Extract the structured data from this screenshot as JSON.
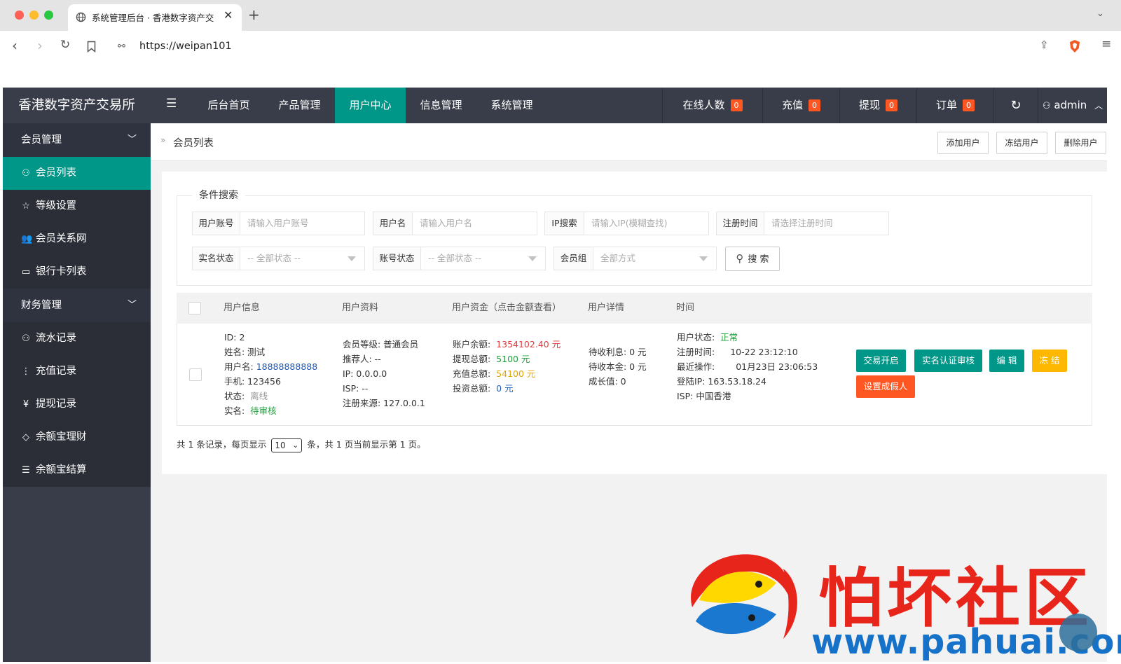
{
  "browser": {
    "tab_title": "系统管理后台 · 香港数字资产交",
    "url": "https://weipan101"
  },
  "header": {
    "logo": "香港数字资产交易所",
    "nav": [
      "后台首页",
      "产品管理",
      "用户中心",
      "信息管理",
      "系统管理"
    ],
    "active_nav": "用户中心",
    "stats": [
      {
        "label": "在线人数",
        "count": "0"
      },
      {
        "label": "充值",
        "count": "0"
      },
      {
        "label": "提现",
        "count": "0"
      },
      {
        "label": "订单",
        "count": "0"
      }
    ],
    "user": "admin"
  },
  "sidebar": {
    "groups": [
      {
        "label": "会员管理",
        "items": [
          {
            "label": "会员列表",
            "icon": "user-icon",
            "active": true
          },
          {
            "label": "等级设置",
            "icon": "star-icon"
          },
          {
            "label": "会员关系网",
            "icon": "users-icon"
          },
          {
            "label": "银行卡列表",
            "icon": "credit-card-icon"
          }
        ]
      },
      {
        "label": "财务管理",
        "items": [
          {
            "label": "流水记录",
            "icon": "user-icon"
          },
          {
            "label": "充值记录",
            "icon": "dots-vertical-icon"
          },
          {
            "label": "提现记录",
            "icon": "yen-icon"
          },
          {
            "label": "余额宝理财",
            "icon": "diamond-icon"
          },
          {
            "label": "余额宝结算",
            "icon": "list-icon"
          }
        ]
      }
    ]
  },
  "breadcrumb": {
    "current": "会员列表"
  },
  "toolbar": {
    "add": "添加用户",
    "freeze": "冻结用户",
    "delete": "删除用户"
  },
  "search": {
    "legend": "条件搜索",
    "fields": [
      {
        "label": "用户账号",
        "placeholder": "请输入用户账号"
      },
      {
        "label": "用户名",
        "placeholder": "请输入用户名"
      },
      {
        "label": "IP搜索",
        "placeholder": "请输入IP(模糊查找)"
      },
      {
        "label": "注册时间",
        "placeholder": "请选择注册时间"
      }
    ],
    "selects": [
      {
        "label": "实名状态",
        "value": "-- 全部状态 --"
      },
      {
        "label": "账号状态",
        "value": "-- 全部状态 --"
      },
      {
        "label": "会员组",
        "value": "全部方式"
      }
    ],
    "button": "搜 索"
  },
  "table": {
    "headers": [
      "用户信息",
      "用户资料",
      "用户资金（点击金额查看）",
      "用户详情",
      "时间"
    ],
    "row": {
      "info": {
        "id": "ID:  2",
        "name": "姓名:  测试",
        "username_label": "用户名:",
        "username": "18888888888",
        "phone": "手机:  123456",
        "status_label": "状态:",
        "status": "离线",
        "realname_label": "实名:",
        "realname": "待审核"
      },
      "profile": {
        "level": "会员等级:  普通会员",
        "referrer": "推荐人:  --",
        "ip": "IP:  0.0.0.0",
        "isp": "ISP:  --",
        "source": "注册来源:  127.0.0.1"
      },
      "funds": {
        "balance_label": "账户余额:",
        "balance": "1354102.40 元",
        "withdraw_label": "提现总额:",
        "withdraw": "5100 元",
        "recharge_label": "充值总额:",
        "recharge": "54100 元",
        "invest_label": "投资总额:",
        "invest": "0 元"
      },
      "details": {
        "interest": "待收利息:  0 元",
        "principal": "待收本金:  0 元",
        "growth": "成长值:  0"
      },
      "time": {
        "state_label": "用户状态:",
        "state": "正常",
        "reg_label": "注册时间:",
        "reg": "10-22 23:12:10",
        "last_label": "最近操作:",
        "last": "01月23日 23:06:53",
        "login_ip": "登陆IP:  163.53.18.24",
        "isp": "ISP:  中国香港"
      },
      "actions": [
        "交易开启",
        "实名认证审核",
        "编 辑",
        "冻 结",
        "设置成假人"
      ]
    }
  },
  "pager": {
    "prefix": "共 1 条记录，每页显示",
    "page_size": "10",
    "suffix": "条，共 1 页当前显示第 1 页。"
  },
  "watermark": {
    "text": "怕坏社区",
    "url": "www.pahuai.com"
  },
  "colors": {
    "header": "#393d49",
    "active": "#009688",
    "badge": "#ff5722",
    "freeze": "#ffb800"
  }
}
